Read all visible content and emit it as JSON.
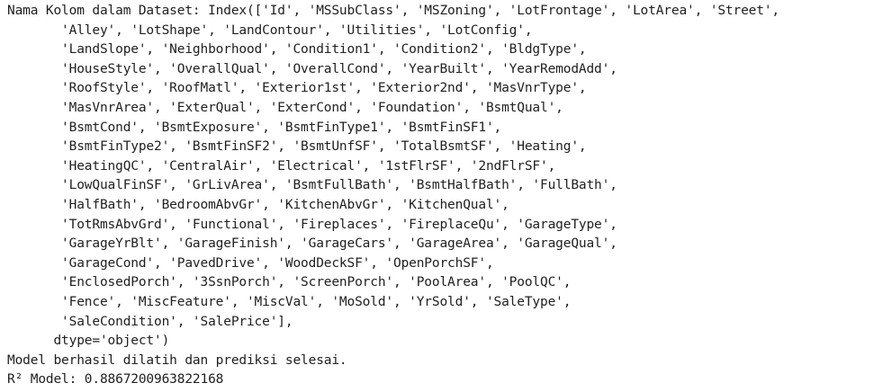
{
  "output": {
    "lines": [
      "Nama Kolom dalam Dataset: Index(['Id', 'MSSubClass', 'MSZoning', 'LotFrontage', 'LotArea', 'Street',",
      "       'Alley', 'LotShape', 'LandContour', 'Utilities', 'LotConfig',",
      "       'LandSlope', 'Neighborhood', 'Condition1', 'Condition2', 'BldgType',",
      "       'HouseStyle', 'OverallQual', 'OverallCond', 'YearBuilt', 'YearRemodAdd',",
      "       'RoofStyle', 'RoofMatl', 'Exterior1st', 'Exterior2nd', 'MasVnrType',",
      "       'MasVnrArea', 'ExterQual', 'ExterCond', 'Foundation', 'BsmtQual',",
      "       'BsmtCond', 'BsmtExposure', 'BsmtFinType1', 'BsmtFinSF1',",
      "       'BsmtFinType2', 'BsmtFinSF2', 'BsmtUnfSF', 'TotalBsmtSF', 'Heating',",
      "       'HeatingQC', 'CentralAir', 'Electrical', '1stFlrSF', '2ndFlrSF',",
      "       'LowQualFinSF', 'GrLivArea', 'BsmtFullBath', 'BsmtHalfBath', 'FullBath',",
      "       'HalfBath', 'BedroomAbvGr', 'KitchenAbvGr', 'KitchenQual',",
      "       'TotRmsAbvGrd', 'Functional', 'Fireplaces', 'FireplaceQu', 'GarageType',",
      "       'GarageYrBlt', 'GarageFinish', 'GarageCars', 'GarageArea', 'GarageQual',",
      "       'GarageCond', 'PavedDrive', 'WoodDeckSF', 'OpenPorchSF',",
      "       'EnclosedPorch', '3SsnPorch', 'ScreenPorch', 'PoolArea', 'PoolQC',",
      "       'Fence', 'MiscFeature', 'MiscVal', 'MoSold', 'YrSold', 'SaleType',",
      "       'SaleCondition', 'SalePrice'],",
      "      dtype='object')",
      "Model berhasil dilatih dan prediksi selesai.",
      "R² Model: 0.8867200963822168"
    ]
  }
}
